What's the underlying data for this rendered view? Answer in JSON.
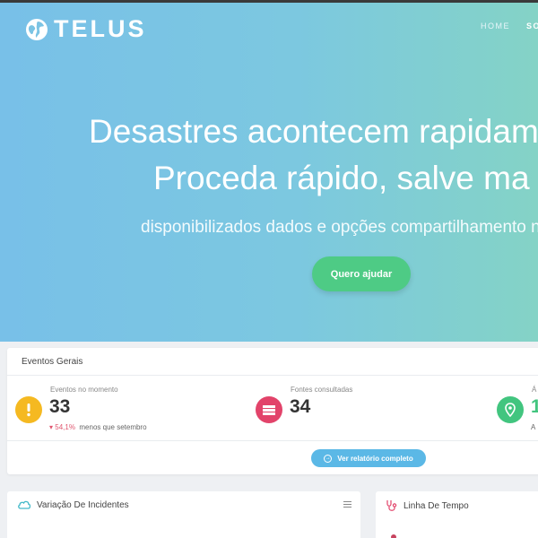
{
  "brand": {
    "name": "TELUS",
    "logo_icon": "globe-icon"
  },
  "nav": {
    "items": [
      "HOME",
      "SOB"
    ]
  },
  "hero": {
    "headline_line1": "Desastres acontecem rapidam",
    "headline_line2": "Proceda rápido, salve ma",
    "subheadline": "disponibilizados dados e opções compartilhamento n",
    "cta_label": "Quero ajudar"
  },
  "events": {
    "title": "Eventos Gerais",
    "stats": [
      {
        "label": "Eventos no momento",
        "value": "33",
        "trend_pct": "54,1%",
        "trend_text": "menos que setembro",
        "icon": "warning-icon",
        "color": "#f5b921"
      },
      {
        "label": "Fontes consultadas",
        "value": "34",
        "icon": "stack-icon",
        "color": "#e2436a"
      },
      {
        "label": "Á",
        "value": "1",
        "subtext": "A",
        "icon": "map-pin-icon",
        "color": "#42c57f"
      }
    ],
    "report_button": "Ver relatório completo"
  },
  "incidents": {
    "title": "Variação De Incidentes",
    "icon": "cloud-icon"
  },
  "timeline": {
    "title": "Linha De Tempo",
    "icon": "stethoscope-icon"
  },
  "colors": {
    "accent_green": "#4ecb85",
    "accent_blue": "#5bb8e6"
  }
}
